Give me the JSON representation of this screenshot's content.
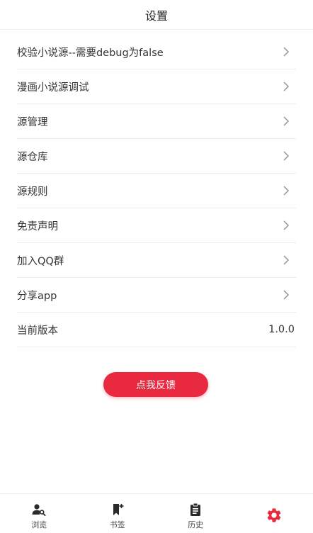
{
  "header": {
    "title": "设置"
  },
  "settings": {
    "items": [
      {
        "label": "校验小说源--需要debug为false"
      },
      {
        "label": "漫画小说源调试"
      },
      {
        "label": "源管理"
      },
      {
        "label": "源仓库"
      },
      {
        "label": "源规则"
      },
      {
        "label": "免责声明"
      },
      {
        "label": "加入QQ群"
      },
      {
        "label": "分享app"
      },
      {
        "label": "当前版本",
        "value": "1.0.0"
      }
    ]
  },
  "feedback_button": {
    "label": "点我反馈"
  },
  "bottom_nav": {
    "items": [
      {
        "label": "浏览",
        "icon": "person-search-icon"
      },
      {
        "label": "书签",
        "icon": "bookmark-add-icon"
      },
      {
        "label": "历史",
        "icon": "clipboard-icon"
      },
      {
        "label": "",
        "icon": "settings-gear-icon",
        "active": true
      }
    ]
  },
  "colors": {
    "accent": "#e8293f",
    "text": "#333333",
    "divider": "#ececec",
    "chevron": "#9e9e9e"
  }
}
